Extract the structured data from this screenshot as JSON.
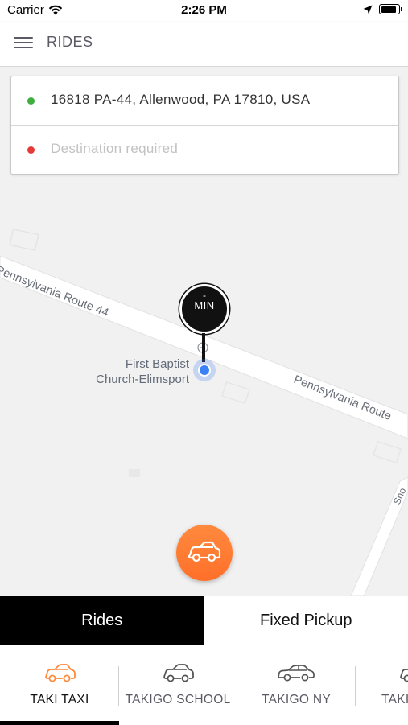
{
  "status_bar": {
    "carrier": "Carrier",
    "time": "2:26 PM",
    "battery_level": 0.95
  },
  "header": {
    "title": "RIDES",
    "menu_icon": "hamburger-menu-icon"
  },
  "trip": {
    "pickup": "16818 PA-44, Allenwood, PA 17810, USA",
    "pickup_dot_color": "#3fae3f",
    "destination_placeholder": "Destination required",
    "destination_dot_color": "#e53935"
  },
  "map": {
    "road_top": "Pennsylvania Route 44",
    "road_right": "Pennsylvania Route",
    "road_side": "Sno",
    "poi_line1": "First Baptist",
    "poi_line2": "Church-Elimsport",
    "eta_value": "-",
    "eta_unit": "MIN",
    "pin_color": "#111111",
    "location_color": "#3b82f6"
  },
  "fab": {
    "icon": "car-icon",
    "color": "#ff7a33"
  },
  "mode_tabs": [
    {
      "label": "Rides",
      "active": true
    },
    {
      "label": "Fixed Pickup",
      "active": false
    }
  ],
  "vehicles": [
    {
      "label": "TAKI TAXI",
      "icon": "car-icon",
      "selected": true,
      "icon_color": "#ff8a3d"
    },
    {
      "label": "TAKIGO SCHOOL",
      "icon": "car-icon",
      "selected": false,
      "icon_color": "#555555"
    },
    {
      "label": "TAKIGO NY",
      "icon": "sedan-icon",
      "selected": false,
      "icon_color": "#555555"
    },
    {
      "label": "TAKI",
      "icon": "car-icon",
      "selected": false,
      "icon_color": "#555555"
    }
  ]
}
